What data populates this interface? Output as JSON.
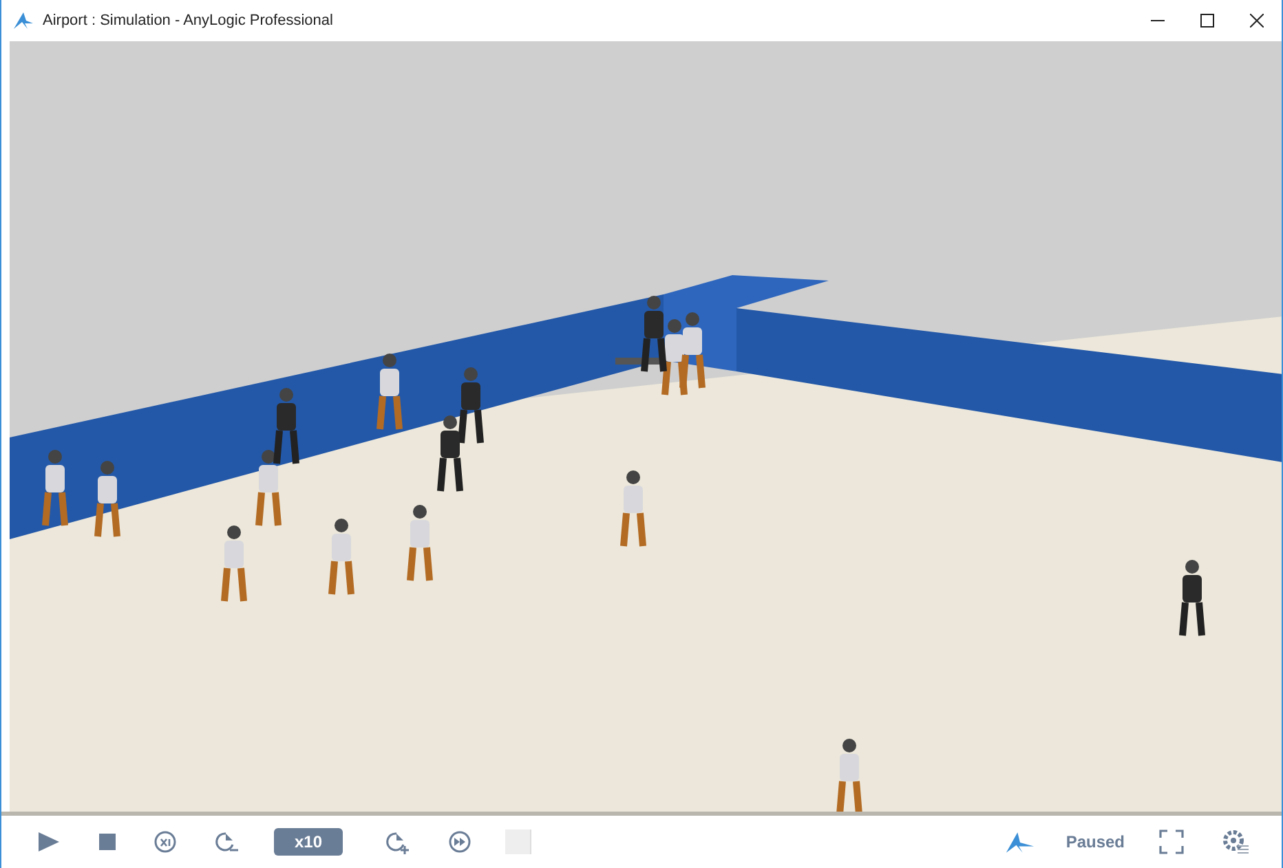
{
  "window": {
    "title": "Airport : Simulation - AnyLogic Professional"
  },
  "toolbar": {
    "speed": "x10",
    "status": "Paused"
  }
}
